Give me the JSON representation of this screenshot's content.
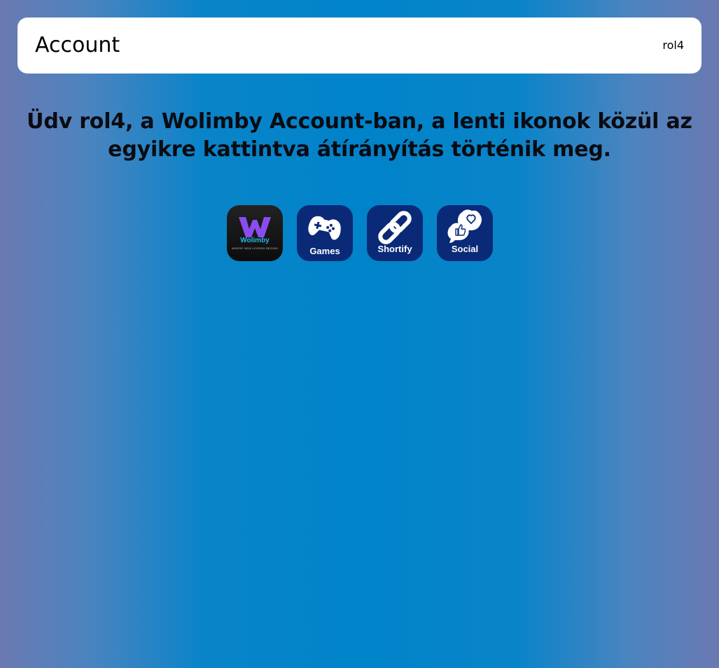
{
  "header": {
    "title": "Account",
    "username": "rol4"
  },
  "welcome": {
    "text": "Üdv rol4, a Wolimby Account-ban, a lenti ikonok közül az egyikre kattintva átírányítás történik meg."
  },
  "apps": [
    {
      "name": "Wolimby",
      "tagline": "WHERE NEW LEGEND BEGINS",
      "icon": "wolimby-logo-icon"
    },
    {
      "name": "Games",
      "icon": "gamepad-icon"
    },
    {
      "name": "Shortify",
      "icon": "chain-link-icon"
    },
    {
      "name": "Social",
      "icon": "social-thumbs-heart-icon"
    }
  ],
  "colors": {
    "background_center": "#0083c9",
    "background_edge": "#6b79b2",
    "app_tile": "#0a2a78",
    "wolimby_purple": "#8a4cf0",
    "wolimby_blue": "#27b6e8"
  }
}
